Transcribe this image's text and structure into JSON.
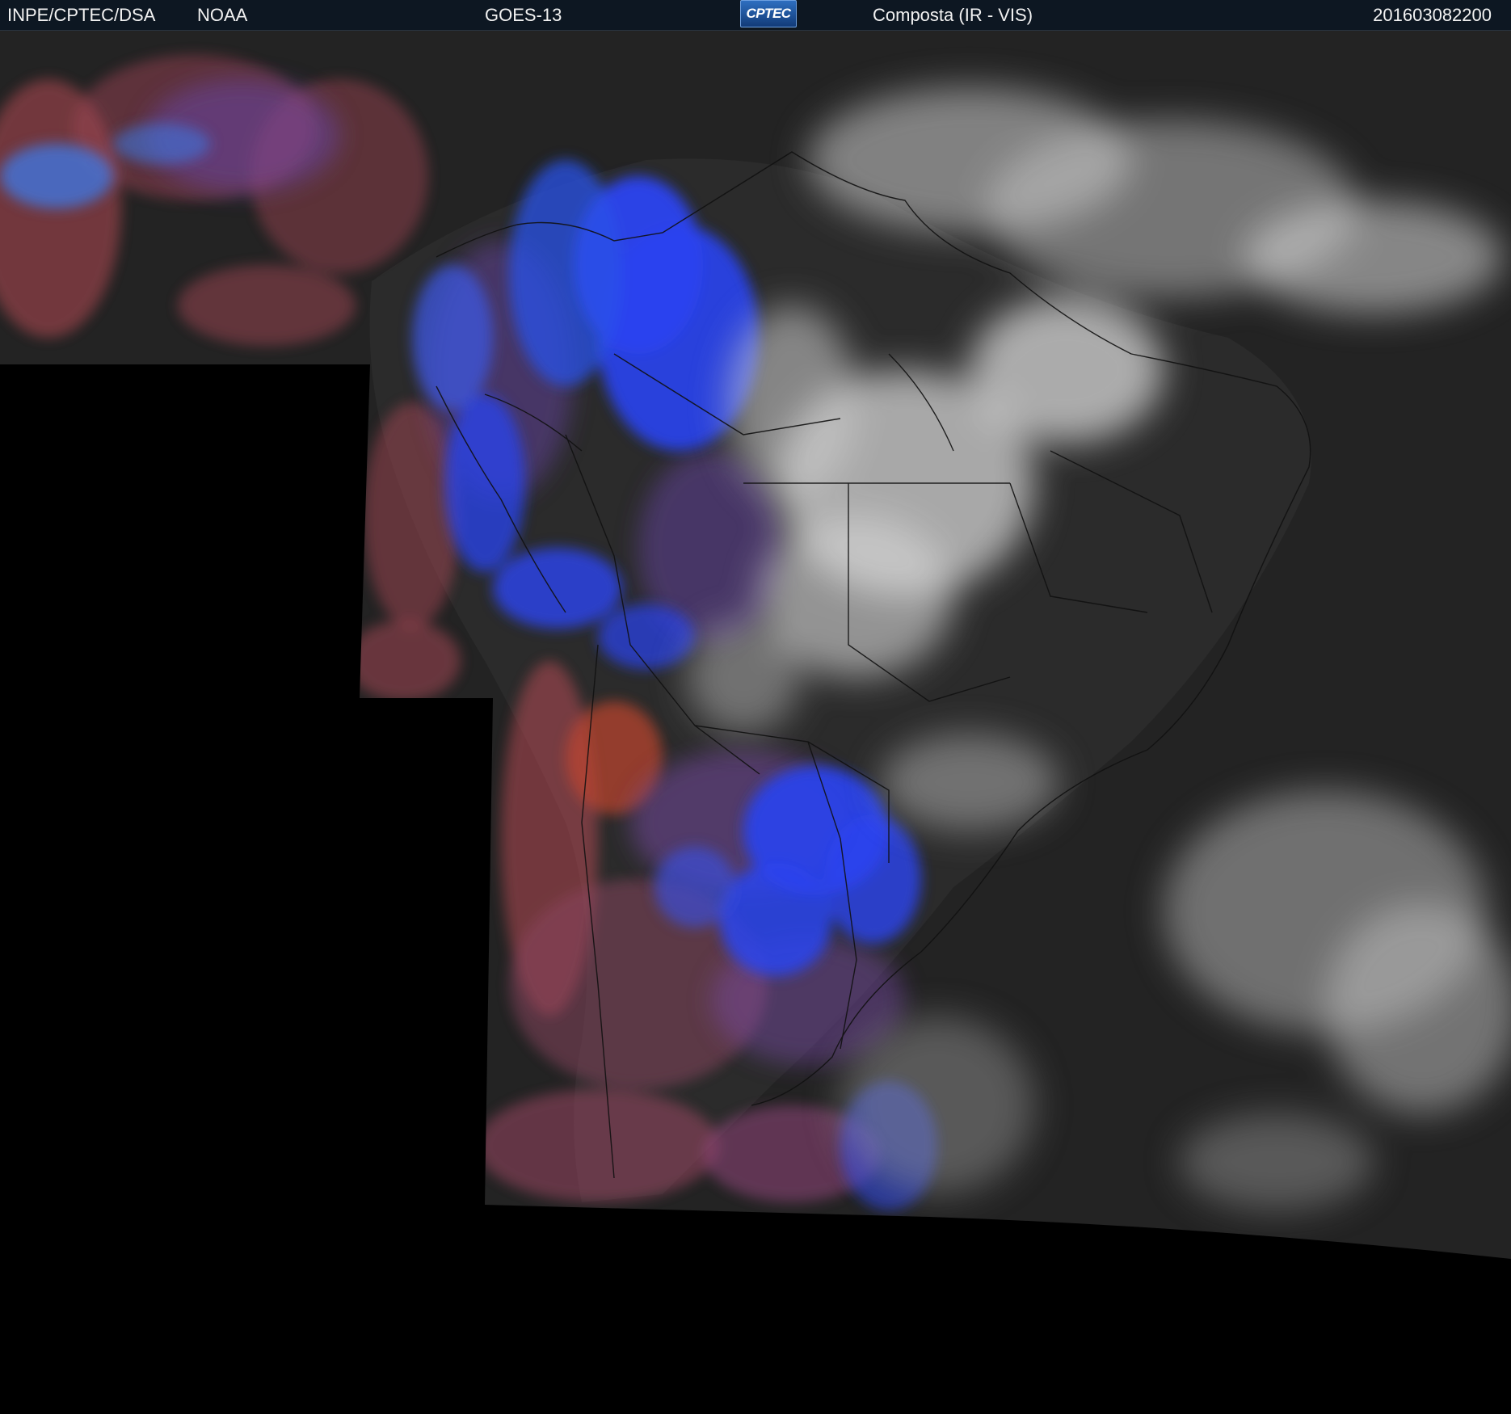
{
  "header": {
    "organization": "INPE/CPTEC/DSA",
    "agency": "NOAA",
    "satellite": "GOES-13",
    "logo_text": "CPTEC",
    "product": "Composta (IR - VIS)",
    "timestamp": "201603082200"
  },
  "colors": {
    "header_bg": "#0d1722",
    "ocean_dark": "#232323",
    "land_dark": "#2a2a2a",
    "cloud_white": "#e6e6e6",
    "cloud_blue": "#2a44f0",
    "cloud_red": "#c84a54",
    "cloud_purple": "#7a4aa8",
    "no_data": "#000000"
  },
  "image": {
    "type": "satellite composite",
    "region": "South America",
    "overlays": [
      "country-borders",
      "state-borders"
    ]
  }
}
